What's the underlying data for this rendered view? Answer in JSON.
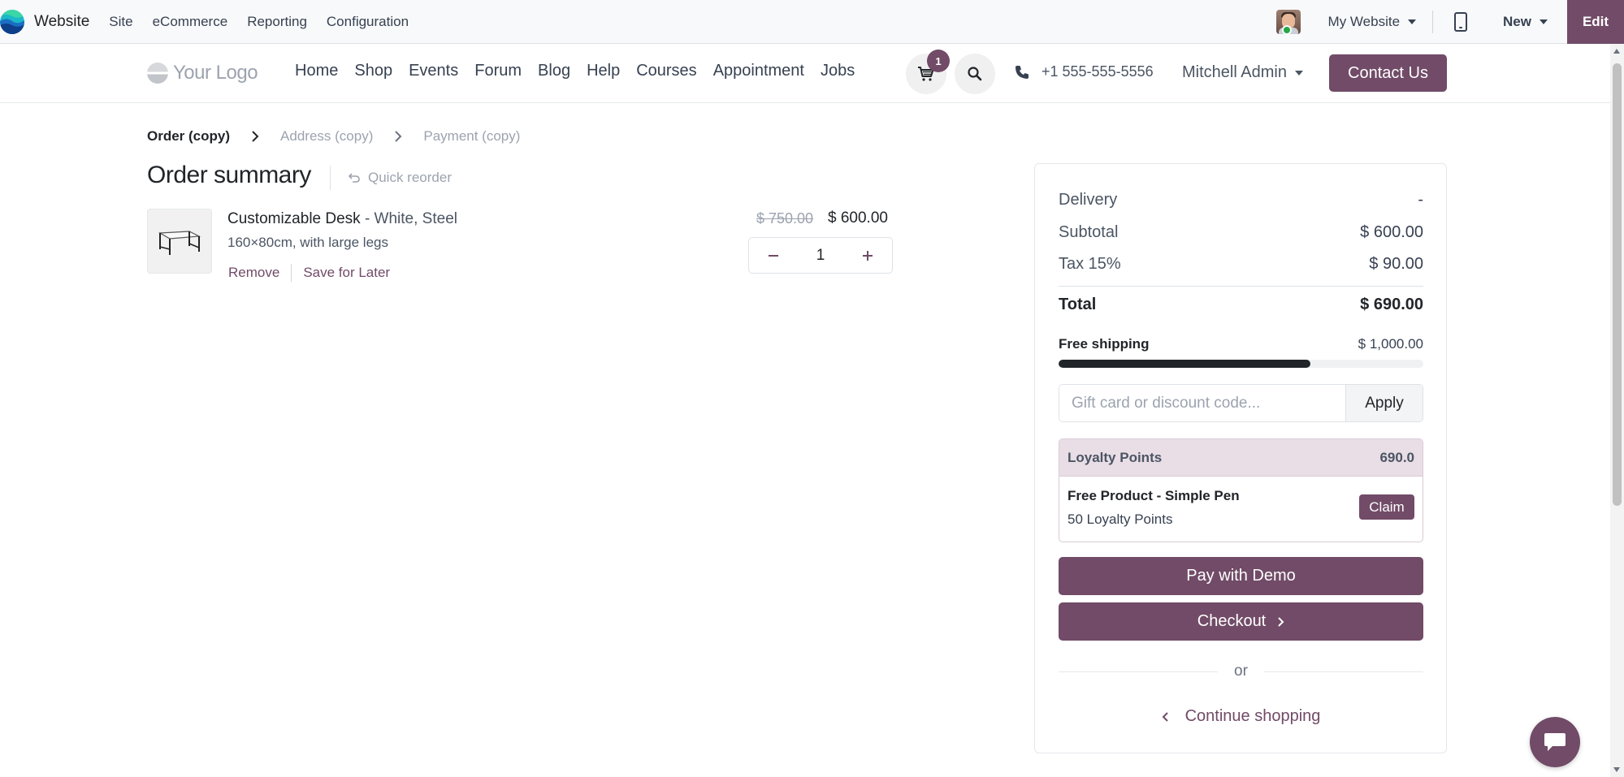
{
  "adminbar": {
    "app_title": "Website",
    "menu": [
      "Site",
      "eCommerce",
      "Reporting",
      "Configuration"
    ],
    "website_selector": "My Website",
    "new_label": "New",
    "edit_label": "Edit"
  },
  "header": {
    "logo_text": "Your Logo",
    "nav": [
      "Home",
      "Shop",
      "Events",
      "Forum",
      "Blog",
      "Help",
      "Courses",
      "Appointment",
      "Jobs"
    ],
    "cart_count": "1",
    "phone": "+1 555-555-5556",
    "user": "Mitchell Admin",
    "contact_label": "Contact Us"
  },
  "steps": {
    "active": "Order (copy)",
    "items": [
      "Address (copy)",
      "Payment (copy)"
    ]
  },
  "order": {
    "title": "Order summary",
    "quick_reorder": "Quick reorder",
    "product": {
      "name": "Customizable Desk",
      "variant": " - White, Steel",
      "description": "160×80cm, with large legs",
      "remove_label": "Remove",
      "save_label": "Save for Later",
      "old_price": "$ 750.00",
      "price": "$ 600.00",
      "quantity": "1"
    }
  },
  "summary": {
    "delivery_label": "Delivery",
    "delivery_value": "-",
    "subtotal_label": "Subtotal",
    "subtotal_value": "$ 600.00",
    "tax_label": "Tax 15%",
    "tax_value": "$ 90.00",
    "total_label": "Total",
    "total_value": "$ 690.00",
    "free_shipping_label": "Free shipping",
    "free_shipping_threshold": "$ 1,000.00",
    "free_shipping_progress": 0.69,
    "promo_placeholder": "Gift card or discount code...",
    "apply_label": "Apply",
    "loyalty": {
      "title": "Loyalty Points",
      "value": "690.0",
      "reward_name": "Free Product - Simple Pen",
      "reward_points": "50 Loyalty Points",
      "claim_label": "Claim"
    },
    "pay_label": "Pay with Demo",
    "checkout_label": "Checkout",
    "or_label": "or",
    "continue_label": "Continue shopping"
  },
  "colors": {
    "brand": "#714b67",
    "text": "#212529",
    "muted": "#9ca3af"
  }
}
